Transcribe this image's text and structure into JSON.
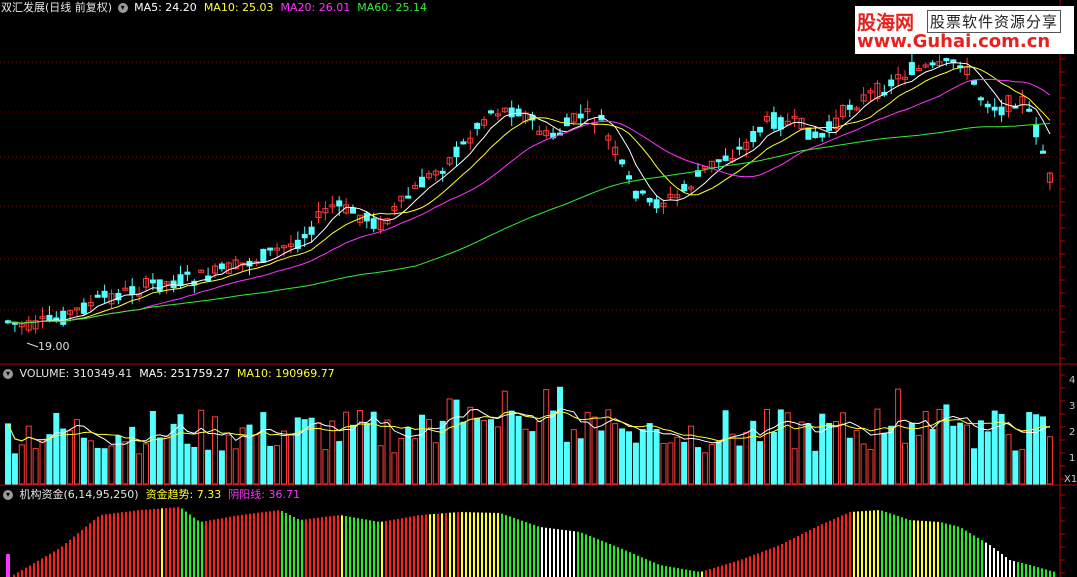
{
  "main_panel": {
    "title": "双汇发展(日线 前复权)",
    "indicators": [
      {
        "label": "MA5: 24.20",
        "color": "#ffffff"
      },
      {
        "label": "MA10: 25.03",
        "color": "#ffff33"
      },
      {
        "label": "MA20: 26.01",
        "color": "#ff33ff"
      },
      {
        "label": "MA60: 25.14",
        "color": "#33ee33"
      }
    ],
    "low_marker": "19.00"
  },
  "volume_panel": {
    "name": "VOLUME:",
    "value": "310349.41",
    "ma5_label": "MA5: 251759.27",
    "ma10_label": "MA10: 190969.77",
    "axis_ticks": [
      "4",
      "3",
      "2",
      "1",
      "X1"
    ]
  },
  "fund_panel": {
    "name": "机构资金(6,14,95,250)",
    "trend_label": "资金趋势: 7.33",
    "yinyang_label": "阴阳线: 36.71"
  },
  "watermark": {
    "site_cn": "股海网",
    "tagline": "股票软件资源分享",
    "url": "www.Guhai.com.cn"
  },
  "colors": {
    "up": "#ff3c3c",
    "down": "#54ffff",
    "ma5": "#ffffff",
    "ma10": "#ffff33",
    "ma20": "#ff33ff",
    "ma60": "#33ee33",
    "grid": "#8b0000",
    "fund_red": "#ff1e1e",
    "fund_green": "#22ee22",
    "fund_yellow": "#ffff22",
    "fund_white": "#ffffff"
  }
}
